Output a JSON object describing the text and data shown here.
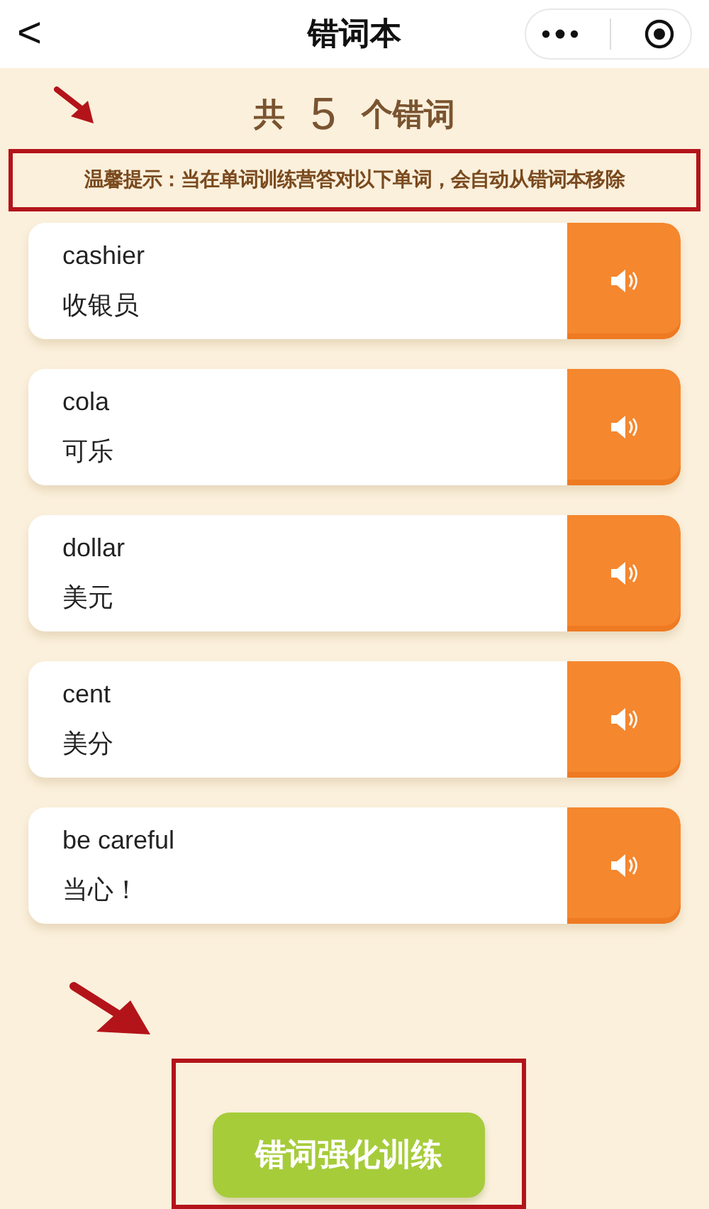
{
  "nav": {
    "back": "<",
    "title": "错词本"
  },
  "count_title": {
    "prefix": "共",
    "count": "5",
    "suffix": "个错词"
  },
  "tip": "温馨提示：当在单词训练营答对以下单词，会自动从错词本移除",
  "words": [
    {
      "word": "cashier",
      "meaning": "收银员"
    },
    {
      "word": "cola",
      "meaning": "可乐"
    },
    {
      "word": "dollar",
      "meaning": "美元"
    },
    {
      "word": "cent",
      "meaning": "美分"
    },
    {
      "word": "be careful",
      "meaning": "当心！"
    }
  ],
  "train_button": "错词强化训练"
}
